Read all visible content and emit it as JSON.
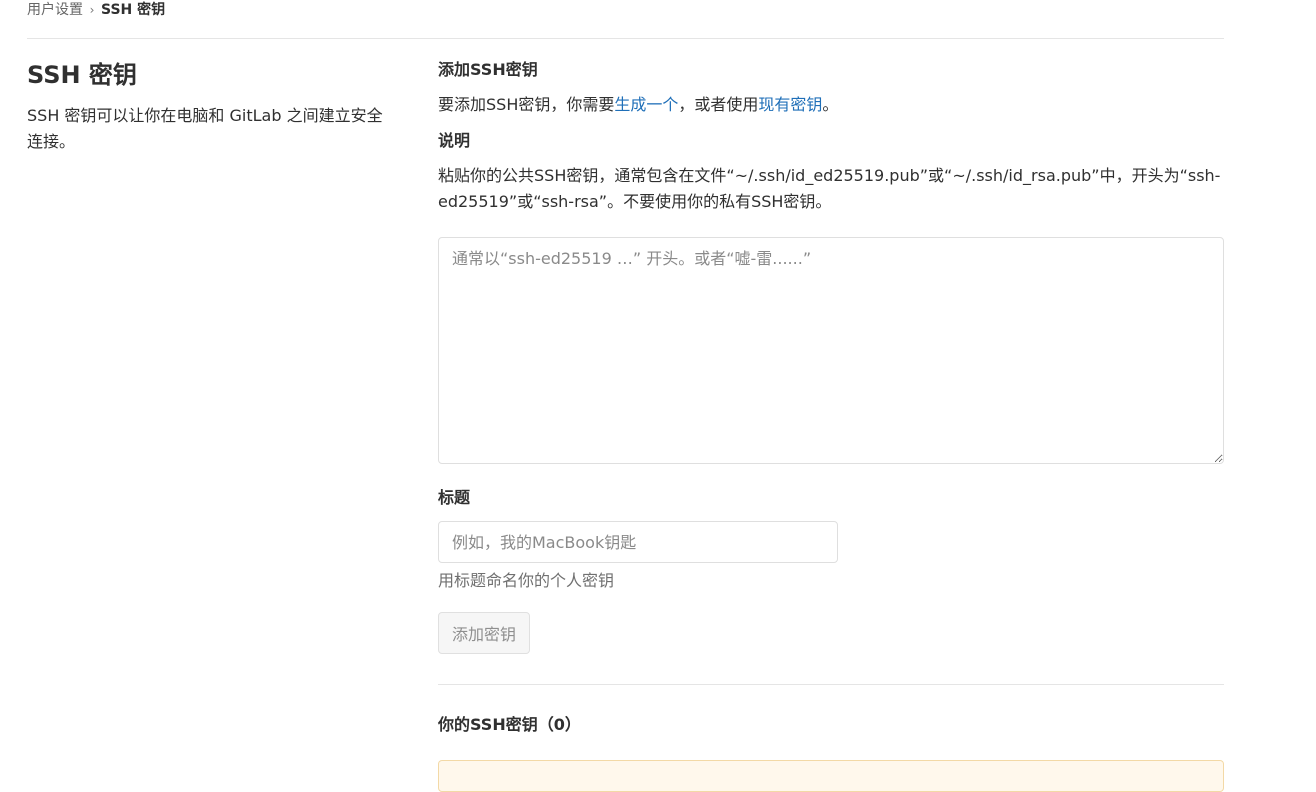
{
  "breadcrumb": {
    "parent": "用户设置",
    "separator": "›",
    "current": "SSH 密钥"
  },
  "left": {
    "title": "SSH 密钥",
    "description": "SSH 密钥可以让你在电脑和 GitLab 之间建立安全连接。"
  },
  "add_key": {
    "heading": "添加SSH密钥",
    "intro_prefix": "要添加SSH密钥，你需要",
    "generate_link": "生成一个",
    "intro_middle": "，或者使用",
    "existing_link": "现有密钥",
    "intro_suffix": "。"
  },
  "description_section": {
    "heading": "说明",
    "text": "粘贴你的公共SSH密钥，通常包含在文件“~/.ssh/id_ed25519.pub”或“~/.ssh/id_rsa.pub”中，开头为“ssh-ed25519”或“ssh-rsa”。不要使用你的私有SSH密钥。"
  },
  "key_field": {
    "value": "",
    "placeholder": "通常以“ssh-ed25519 …” 开头。或者“嘘-雷......”"
  },
  "title_field": {
    "label": "标题",
    "value": "",
    "placeholder": "例如，我的MacBook钥匙",
    "help": "用标题命名你的个人密钥"
  },
  "actions": {
    "add_button": "添加密钥"
  },
  "your_keys": {
    "heading": "你的SSH密钥（0）"
  },
  "colors": {
    "link": "#1f6fb8",
    "text": "#303030",
    "muted": "#707070",
    "border": "#dfdfdf",
    "alert_border": "#f3d9a6",
    "alert_bg": "#fff8ec"
  }
}
